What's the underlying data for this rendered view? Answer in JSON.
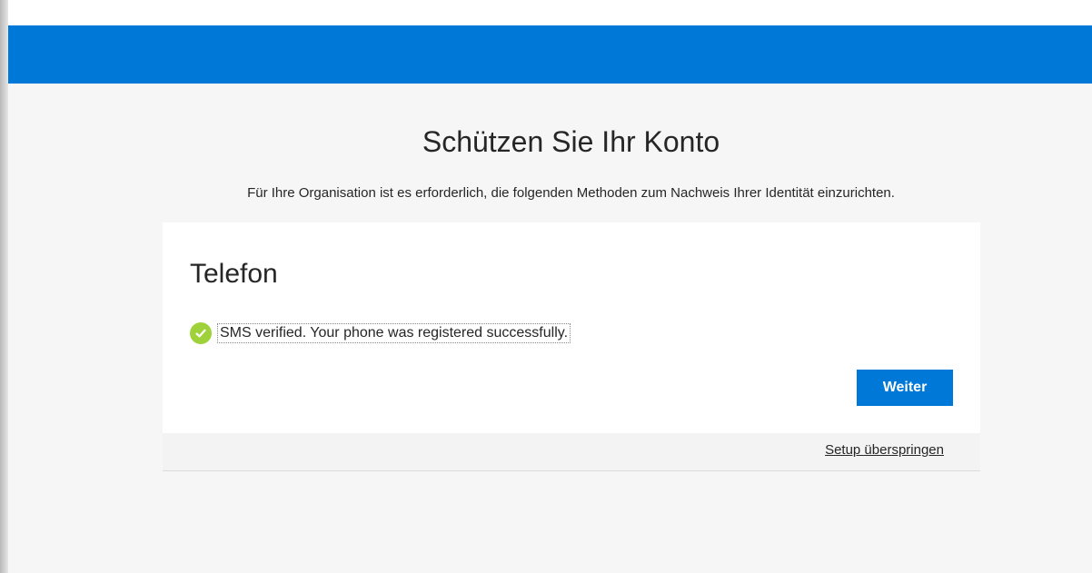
{
  "page": {
    "title": "Schützen Sie Ihr Konto",
    "subtitle": "Für Ihre Organisation ist es erforderlich, die folgenden Methoden zum Nachweis Ihrer Identität einzurichten."
  },
  "card": {
    "method_title": "Telefon",
    "status_icon": "check-circle-icon",
    "status_message": "SMS verified. Your phone was registered successfully.",
    "next_label": "Weiter",
    "skip_label": "Setup überspringen"
  },
  "colors": {
    "header": "#0078d7",
    "accent_button": "#0078d7",
    "success": "#9fd13a",
    "background": "#f6f6f6"
  }
}
